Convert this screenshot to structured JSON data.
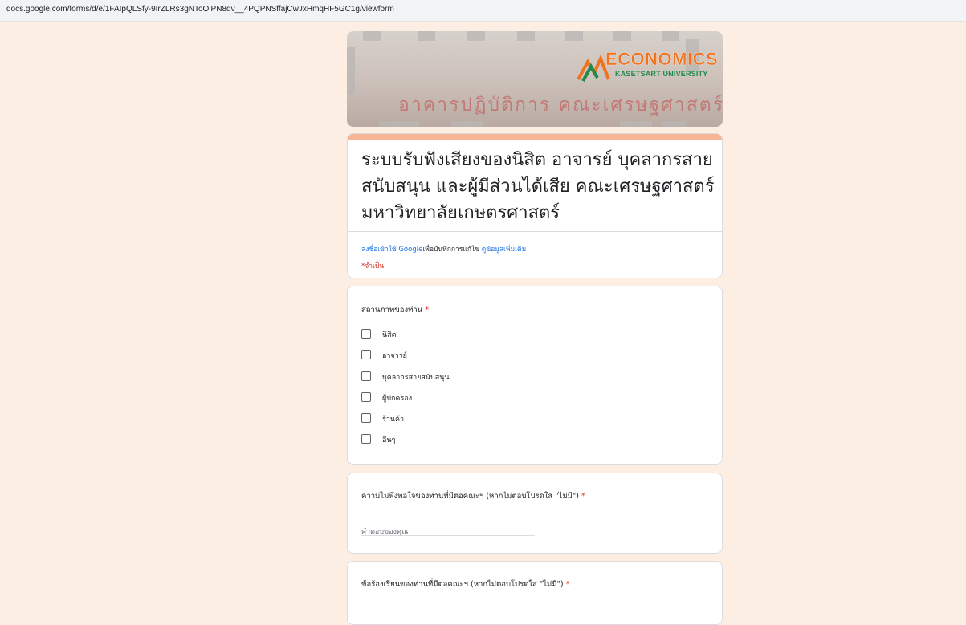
{
  "browser": {
    "url": "docs.google.com/forms/d/e/1FAIpQLSfy-9IrZLRs3gNToOiPN8dv__4PQPNSffajCwJxHmqHF5GC1g/viewform"
  },
  "banner": {
    "logo_text": "ECONOMICS",
    "logo_subtext": "KASETSART UNIVERSITY",
    "building_sign": "อาคารปฏิบัติการ คณะเศรษฐศาสตร์"
  },
  "form": {
    "title": "ระบบรับฟังเสียงของนิสิต อาจารย์ บุคลากรสายสนับสนุน และผู้มีส่วนได้เสีย คณะเศรษฐศาสตร์ มหาวิทยาลัยเกษตรศาสตร์",
    "signin_link": "ลงชื่อเข้าใช้ Google",
    "signin_text": "เพื่อบันทึกการแก้ไข",
    "more_info_link": "ดูข้อมูลเพิ่มเติม",
    "required_note": "*จำเป็น"
  },
  "questions": {
    "status": {
      "title": "สถานภาพของท่าน",
      "required": "*",
      "options": [
        "นิสิต",
        "อาจารย์",
        "บุคลากรสายสนับสนุน",
        "ผู้ปกครอง",
        "ร้านค้า",
        "อื่นๆ"
      ]
    },
    "dissatisfaction": {
      "title": "ความไม่พึงพอใจของท่านที่มีต่อคณะฯ (หากไม่ตอบโปรดใส่ \"ไม่มี\")",
      "required": "*",
      "placeholder": "คำตอบของคุณ"
    },
    "complaint": {
      "title": "ข้อร้องเรียนของท่านที่มีต่อคณะฯ (หากไม่ตอบโปรดใส่ \"ไม่มี\")",
      "required": "*"
    }
  },
  "colors": {
    "theme": "#f6b594",
    "background": "#fdeee4",
    "required": "#d93025",
    "link": "#1a73e8"
  }
}
